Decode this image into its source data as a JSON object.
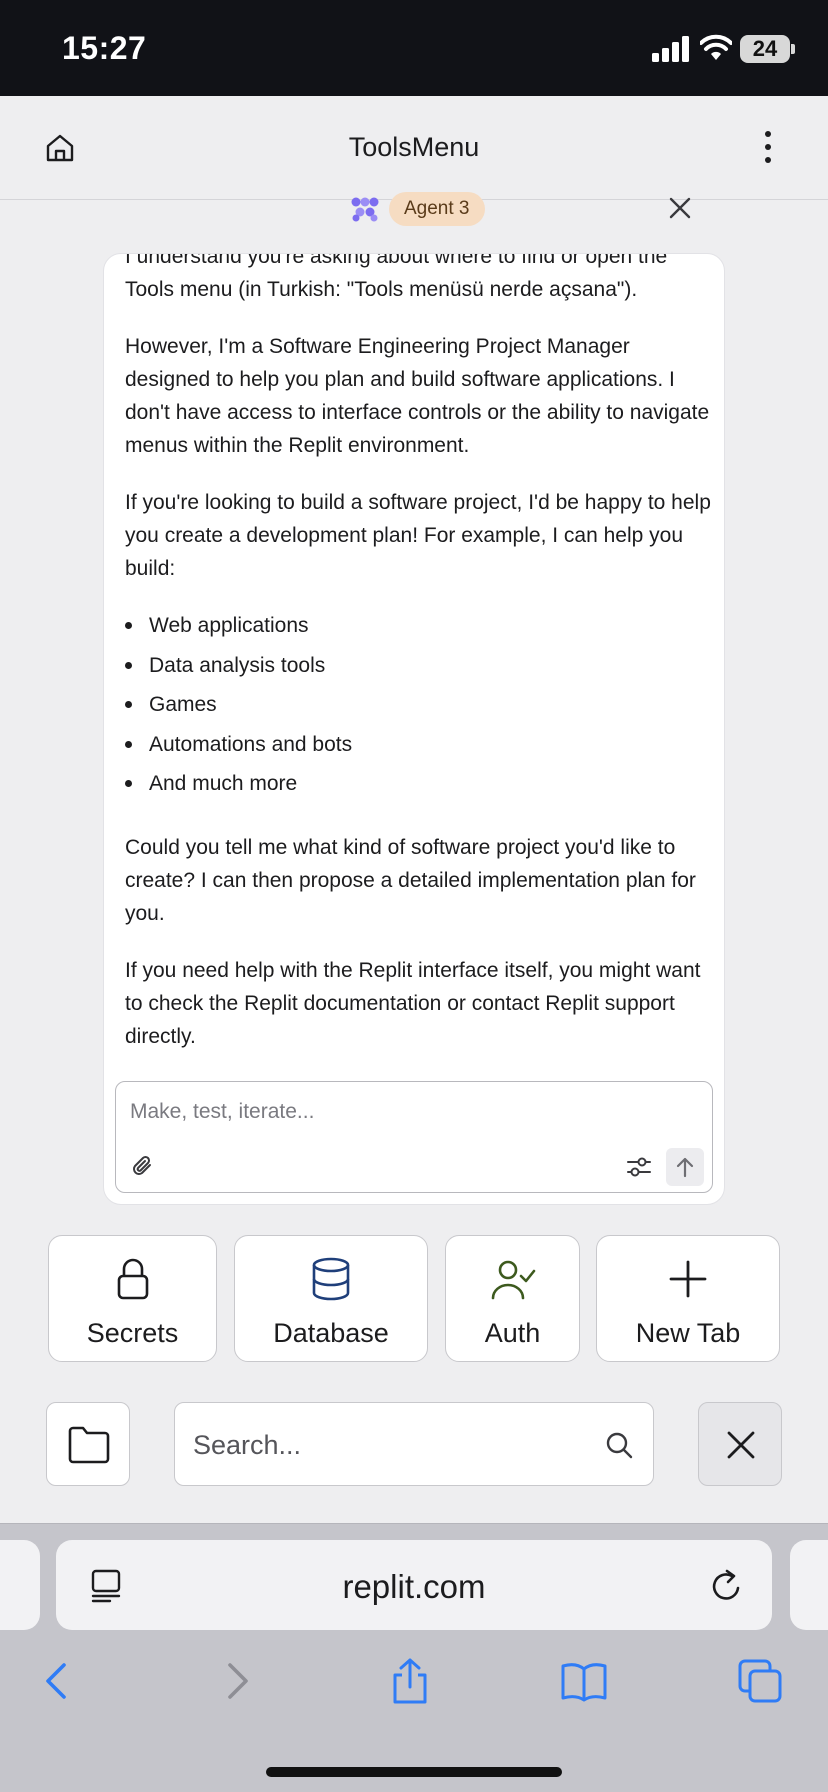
{
  "status_bar": {
    "time": "15:27",
    "battery": "24"
  },
  "header": {
    "title": "ToolsMenu",
    "home_icon": "home-icon",
    "menu_icon": "more-vertical-icon"
  },
  "agent": {
    "badge": "Agent 3",
    "icon": "agent-logo-icon",
    "accent": "#7c6cf0"
  },
  "message": {
    "p1": "I understand you're asking about where to find or open the Tools menu (in Turkish: \"Tools menüsü nerde açsana\").",
    "p2": "However, I'm a Software Engineering Project Manager designed to help you plan and build software applications. I don't have access to interface controls or the ability to navigate menus within the Replit environment.",
    "p3": "If you're looking to build a software project, I'd be happy to help you create a development plan! For example, I can help you build:",
    "bullets": [
      "Web applications",
      "Data analysis tools",
      "Games",
      "Automations and bots",
      "And much more"
    ],
    "p4": "Could you tell me what kind of software project you'd like to create? I can then propose a detailed implementation plan for you.",
    "p5": "If you need help with the Replit interface itself, you might want to check the Replit documentation or contact Replit support directly."
  },
  "composer": {
    "placeholder": "Make, test, iterate..."
  },
  "tools": [
    {
      "label": "Secrets",
      "icon": "lock-icon"
    },
    {
      "label": "Database",
      "icon": "database-icon",
      "color": "#1f3f7a"
    },
    {
      "label": "Auth",
      "icon": "user-check-icon",
      "color": "#3d5a1e"
    },
    {
      "label": "New Tab",
      "icon": "plus-icon"
    }
  ],
  "search": {
    "placeholder": "Search..."
  },
  "browser": {
    "url": "replit.com",
    "accent": "#2f7cf6"
  }
}
